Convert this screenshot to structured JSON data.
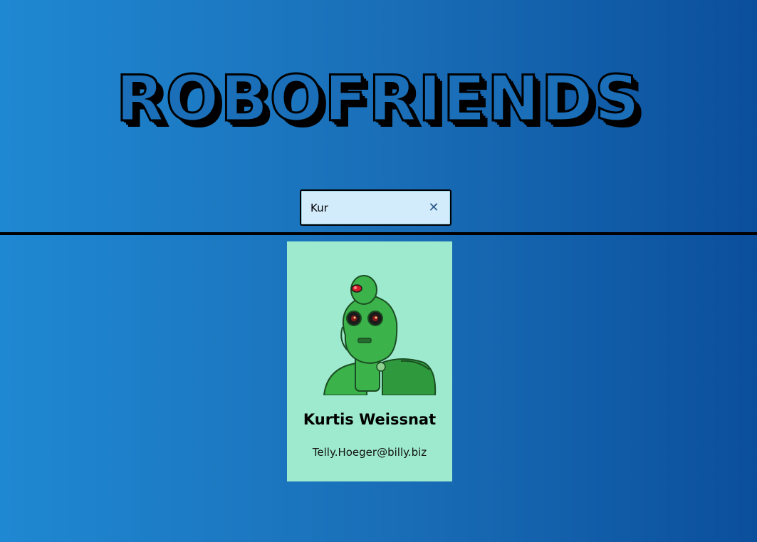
{
  "app": {
    "title": "RoboFriends"
  },
  "search": {
    "value": "Kur",
    "clear_icon": "close-icon",
    "clear_glyph": "✕"
  },
  "cards": [
    {
      "name": "Kurtis Weissnat",
      "email": "Telly.Hoeger@billy.biz",
      "avatar_icon": "robot-avatar"
    }
  ],
  "colors": {
    "background_start": "#1f88d2",
    "background_end": "#0b4f9c",
    "card_background": "#9eeacf",
    "search_background": "#d3ecfb",
    "robot_green": "#3bb24a"
  }
}
